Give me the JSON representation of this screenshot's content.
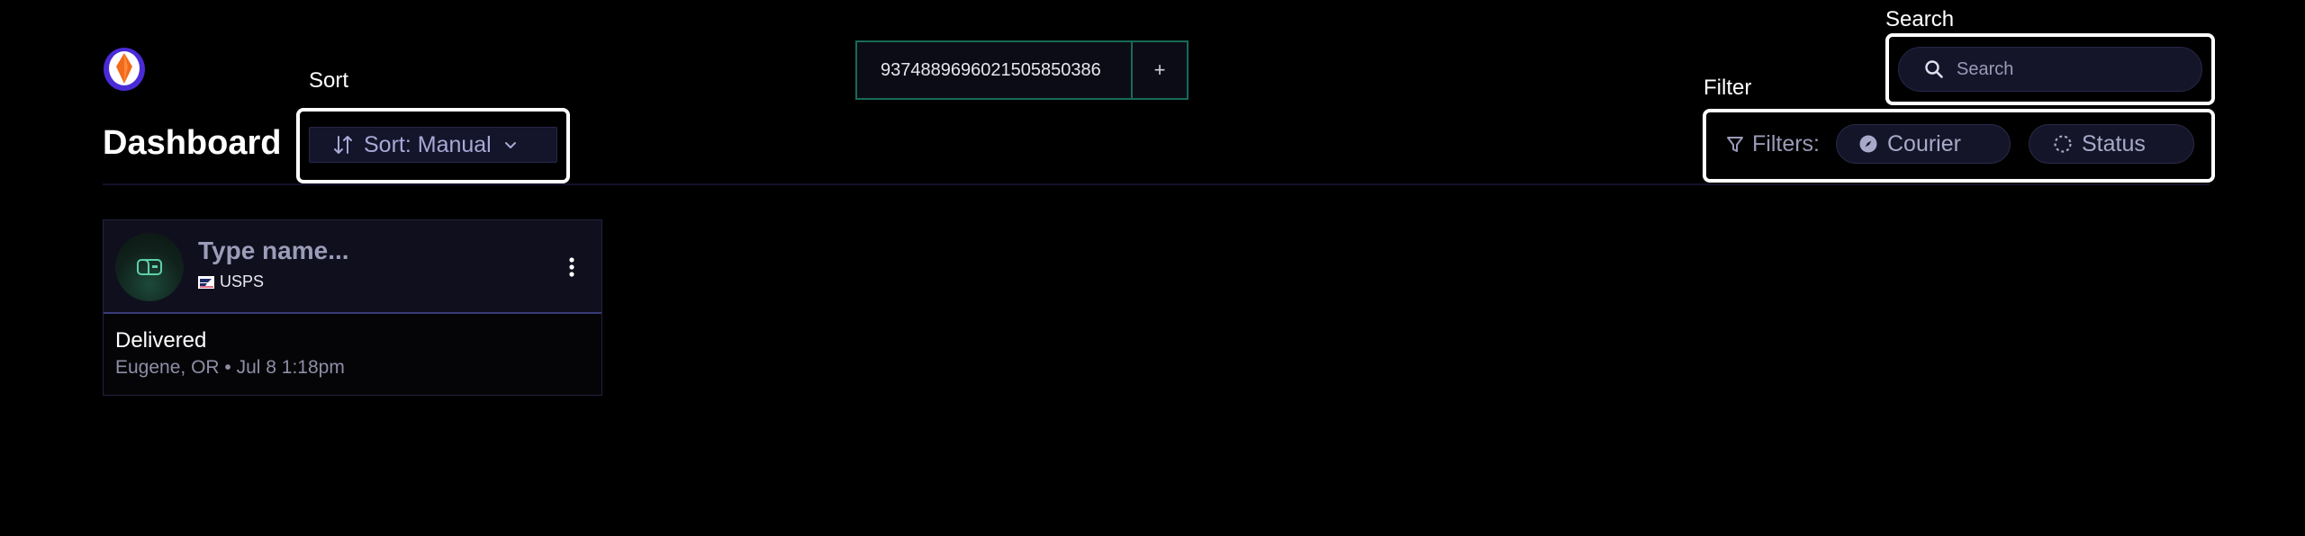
{
  "header": {
    "title": "Dashboard",
    "logo_icon": "courier-logo-icon"
  },
  "callouts": {
    "sort": "Sort",
    "search": "Search",
    "filter": "Filter"
  },
  "sort": {
    "label": "Sort: Manual",
    "icon": "sort-arrows-icon"
  },
  "tracking": {
    "value": "9374889696021505850386",
    "add_label": "+"
  },
  "search": {
    "placeholder": "Search",
    "value": ""
  },
  "filters": {
    "label": "Filters:",
    "chips": [
      {
        "label": "Courier",
        "icon": "compass-icon"
      },
      {
        "label": "Status",
        "icon": "loading-circle-icon"
      }
    ]
  },
  "cards": [
    {
      "name_placeholder": "Type name...",
      "carrier": "USPS",
      "status": "Delivered",
      "location": "Eugene, OR • Jul 8 1:18pm"
    }
  ],
  "colors": {
    "background": "#000000",
    "accent_green": "#176b57",
    "card_header": "#0f0f1e",
    "muted_text": "#9a9ab8"
  }
}
